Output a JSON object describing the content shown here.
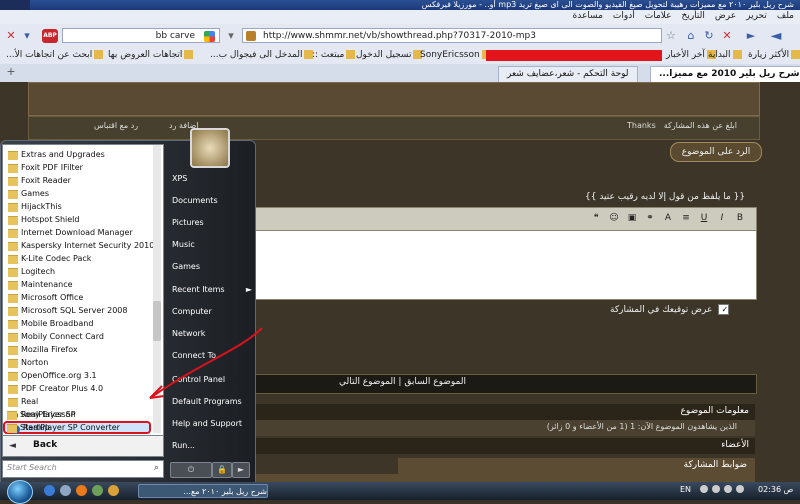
{
  "browser": {
    "title": "أو.. - مورزيلا فيرفكس mp3 شرح ريل بلير ٢٠١٠ مع مميزات رهيبة لتحويل صيغ الفيديو والصوت الى اى صيغ تريد",
    "menu": [
      "ملف",
      "تحرير",
      "عرض",
      "التأريخ",
      "علامات",
      "أدوات",
      "مساعدة"
    ],
    "address": "http://www.shmmr.net/vb/showthread.php?70317-2010-mp3",
    "search_value": "bb carve",
    "abp_label": "ABP",
    "bookmarks": {
      "b1": "الأكثر زيارة",
      "b2": "البداية",
      "b3": "آخر الأخبار",
      "b4": "SonyEricsson",
      "b5": "تسجيل الدخول",
      "b6": "مبتعث ::",
      "b7": "المدخل الى فيجوال ب...",
      "b8": "اتجاهات العروض بها",
      "b9": "ابحث عن اتجاهات الأ..."
    },
    "tabs": {
      "t1": "شرح ريل بلير 2010 مع مميزا...",
      "t2": "لوحة التحكم - شعر،عضايف شعر"
    }
  },
  "page": {
    "post_tools": {
      "thanks": "Thanks",
      "reply_quote": "رد مع اقتباس",
      "reply_quote2": "اضافة رد",
      "report": "ابلغ عن هذه المشاركة"
    },
    "reply_button": "الرد على الموضوع",
    "quote_line": "{{ ما يلفظ من قول إلا لديه رقيب عتيد }}",
    "show_signature": "عرض توقيعك في المشاركة",
    "signature_checkmark": "✓",
    "thread_nav": "الموضوع السابق   |   الموضوع التالي",
    "info_header": "معلومات الموضوع",
    "info_body": "الذين يشاهدون الموضوع الآن: 1 (1 من الأعضاء و 0 زائر)",
    "members_header": "الأعضاء",
    "rules_header": "ضوابط المشاركة"
  },
  "start_menu": {
    "programs": [
      "Extras and Upgrades",
      "Foxit PDF IFilter",
      "Foxit Reader",
      "Games",
      "HijackThis",
      "Hotspot Shield",
      "Internet Download Manager",
      "Kaspersky Internet Security 2010",
      "K-Lite Codec Pack",
      "Logitech",
      "Maintenance",
      "Microsoft Office",
      "Microsoft SQL Server 2008",
      "Mobile Broadband",
      "Mobily Connect Card",
      "Mozilla Firefox",
      "Norton",
      "OpenOffice.org 3.1",
      "PDF Creator Plus 4.0",
      "Real"
    ],
    "sub_items": [
      "RealPlayer SP",
      "RealPlayer SP Converter"
    ],
    "programs_after": [
      "Sony Ericsson",
      "Startup"
    ],
    "back": "Back",
    "search_placeholder": "Start Search",
    "right": [
      "XPS",
      "Documents",
      "Pictures",
      "Music",
      "Games",
      "Recent Items",
      "Computer",
      "Network",
      "Connect To",
      "Control Panel",
      "Default Programs",
      "Help and Support",
      "Run..."
    ]
  },
  "taskbar": {
    "task_label": "شرح ريل بلير ٢٠١٠ مع...",
    "lang": "EN",
    "clock": "ص 02:36"
  },
  "colors": {
    "highlight_border": "#d9121b",
    "redaction": "#e4141c"
  }
}
